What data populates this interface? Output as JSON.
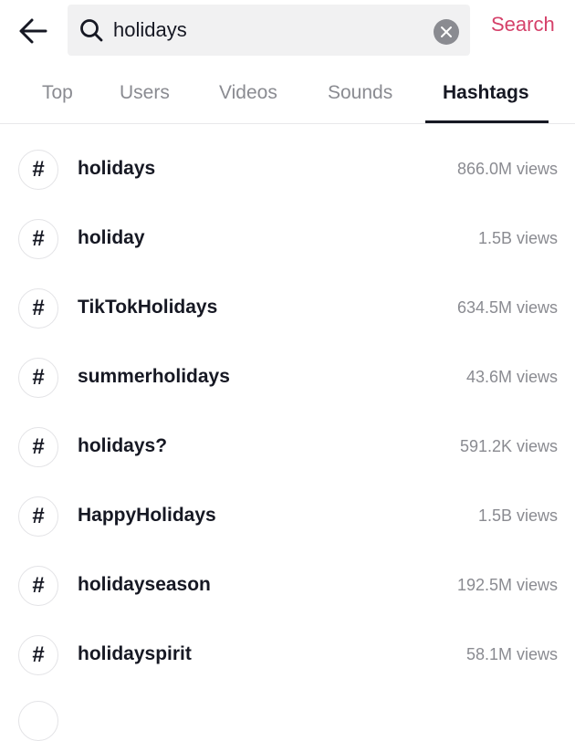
{
  "header": {
    "back_icon": "arrow-left-icon",
    "search_icon": "search-icon",
    "query": "holidays",
    "clear_icon": "close-circle-icon",
    "search_label": "Search",
    "accent_color": "#d5416a"
  },
  "tabs": [
    {
      "label": "Top",
      "active": false
    },
    {
      "label": "Users",
      "active": false
    },
    {
      "label": "Videos",
      "active": false
    },
    {
      "label": "Sounds",
      "active": false
    },
    {
      "label": "Hashtags",
      "active": true
    }
  ],
  "hashtags": [
    {
      "icon": "#",
      "name": "holidays",
      "views": "866.0M views"
    },
    {
      "icon": "#",
      "name": "holiday",
      "views": "1.5B views"
    },
    {
      "icon": "#",
      "name": "TikTokHolidays",
      "views": "634.5M views"
    },
    {
      "icon": "#",
      "name": "summerholidays",
      "views": "43.6M views"
    },
    {
      "icon": "#",
      "name": "holidays?",
      "views": "591.2K views"
    },
    {
      "icon": "#",
      "name": "HappyHolidays",
      "views": "1.5B views"
    },
    {
      "icon": "#",
      "name": "holidayseason",
      "views": "192.5M views"
    },
    {
      "icon": "#",
      "name": "holidayspirit",
      "views": "58.1M views"
    }
  ]
}
